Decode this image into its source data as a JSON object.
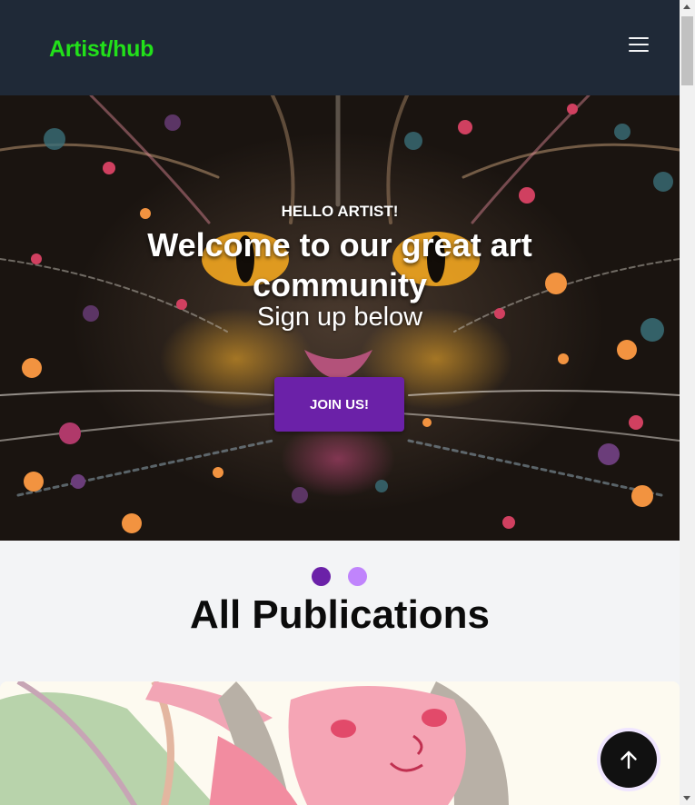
{
  "navbar": {
    "brand": "Artist/hub",
    "menu_icon": "hamburger-menu-icon"
  },
  "hero": {
    "eyebrow": "HELLO ARTIST!",
    "headline": "Welcome to our great art community",
    "subheadline": "Sign up below",
    "cta_label": "JOIN US!",
    "image": "cat-artwork"
  },
  "publications": {
    "title": "All Publications",
    "card_image": "illustrated-character-artwork"
  },
  "back_to_top": {
    "icon": "arrow-up-icon"
  },
  "colors": {
    "navbar_bg": "#1f2937",
    "brand": "#22e01a",
    "accent": "#6b21a8",
    "accent_light": "#c084fc",
    "page_bg": "#f3f4f6"
  }
}
